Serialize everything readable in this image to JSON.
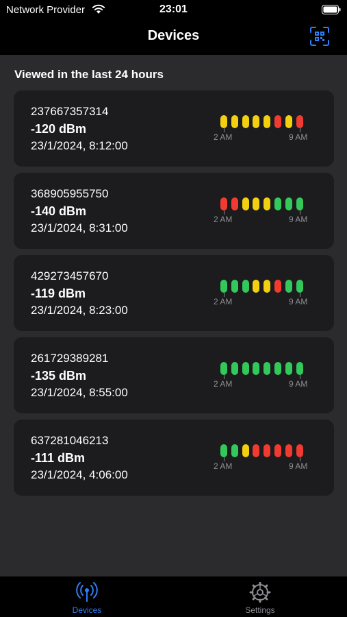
{
  "status_bar": {
    "carrier": "Network Provider",
    "time": "23:01"
  },
  "nav": {
    "title": "Devices",
    "action_icon": "qr-scan-icon"
  },
  "section_title": "Viewed in the last 24 hours",
  "history_axis": {
    "start_label": "2 AM",
    "end_label": "9 AM"
  },
  "colors": {
    "yellow": "#f2d00f",
    "red": "#f23b30",
    "green": "#32c85a",
    "accent": "#2f7ff7"
  },
  "devices": [
    {
      "id": "237667357314",
      "signal": "-120 dBm",
      "time": "23/1/2024, 8:12:00",
      "history": [
        "yellow",
        "yellow",
        "yellow",
        "yellow",
        "yellow",
        "red",
        "yellow",
        "red"
      ]
    },
    {
      "id": "368905955750",
      "signal": "-140 dBm",
      "time": "23/1/2024, 8:31:00",
      "history": [
        "red",
        "red",
        "yellow",
        "yellow",
        "yellow",
        "green",
        "green",
        "green"
      ]
    },
    {
      "id": "429273457670",
      "signal": "-119 dBm",
      "time": "23/1/2024, 8:23:00",
      "history": [
        "green",
        "green",
        "green",
        "yellow",
        "yellow",
        "red",
        "green",
        "green"
      ]
    },
    {
      "id": "261729389281",
      "signal": "-135 dBm",
      "time": "23/1/2024, 8:55:00",
      "history": [
        "green",
        "green",
        "green",
        "green",
        "green",
        "green",
        "green",
        "green"
      ]
    },
    {
      "id": "637281046213",
      "signal": "-111 dBm",
      "time": "23/1/2024, 4:06:00",
      "history": [
        "green",
        "green",
        "yellow",
        "red",
        "red",
        "red",
        "red",
        "red"
      ]
    }
  ],
  "tabs": [
    {
      "label": "Devices",
      "icon": "antenna-icon",
      "active": true
    },
    {
      "label": "Settings",
      "icon": "gear-icon",
      "active": false
    }
  ]
}
